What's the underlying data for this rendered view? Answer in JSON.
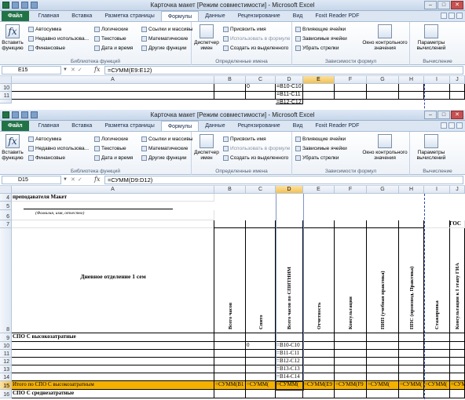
{
  "window1": {
    "title": "Карточка макет  [Режим совместимости] - Microsoft Excel",
    "name_box": "E15",
    "formula": "=СУММ(E9:E12)",
    "rows": [
      "10",
      "11"
    ],
    "cells": {
      "C10": "0",
      "D10": "=B10-C10",
      "D11": "=B11-C11",
      "D12": "=B12-C12"
    }
  },
  "window2": {
    "title": "Карточка макет  [Режим совместимости] - Microsoft Excel",
    "name_box": "D15",
    "formula": "=СУММ(D9:D12)",
    "rows": [
      "4",
      "5",
      "6",
      "7",
      "8",
      "9",
      "10",
      "11",
      "12",
      "13",
      "14",
      "15",
      "16"
    ],
    "cells": {
      "A4": "преподавателя Макет",
      "A6": "(Фамилия, имя, отчество)",
      "I7": "ГОС",
      "A8": "Дневное отделение 1 сем",
      "A9": "СПО С высокозатратные",
      "C10": "0",
      "D10": "=B10-C10",
      "D11": "=B11-C11",
      "D12": "=B12-C12",
      "D13": "=B13-C13",
      "D14": "=B14-C14",
      "A15": "Итого по СПО С высокозатратным",
      "B15": "=СУММ(B1",
      "C15": "=СУММ(",
      "D15": "=СУММ(",
      "E15": "=СУММ(E9",
      "F15": "=СУММ(F9",
      "G15": "=СУММ(",
      "H15": "=СУММ(",
      "I15": "=СУММ(",
      "J15": "=СУММ(",
      "A16": "СПО С среднезатратные"
    },
    "vertical_headers": {
      "B8": "Всего часов",
      "C8": "Спито",
      "D8": "Всего часов по СПИТНИМ",
      "E8": "Отчетность",
      "F8": "Консультации",
      "G8": "ПИП (учебная практика)",
      "H8": "ППС (производ. Практика)",
      "I8": "Стажировка",
      "J8": "Консультации к I этапу ГИА"
    }
  },
  "columns": [
    "A",
    "B",
    "C",
    "D",
    "E",
    "F",
    "G",
    "H",
    "I",
    "J"
  ],
  "tabs": [
    "Файл",
    "Главная",
    "Вставка",
    "Разметка страницы",
    "Формулы",
    "Данные",
    "Рецензирование",
    "Вид",
    "Foxit Reader PDF"
  ],
  "ribbon": {
    "insert_function": "Вставить функцию",
    "autosum": "Автосумма",
    "recent": "Недавно использова...",
    "financial": "Финансовые",
    "logical": "Логические",
    "text": "Текстовые",
    "datetime": "Дата и время",
    "lookup": "Ссылки и массивы",
    "math": "Математические",
    "other": "Другие функции",
    "group_library": "Библиотека функций",
    "name_manager": "Диспетчер имен",
    "define_name": "Присвоить имя",
    "use_in_formula": "Использовать в формуле",
    "create_from_selection": "Создать из выделенного",
    "group_names": "Определенные имена",
    "trace_precedents": "Влияющие ячейки",
    "trace_dependents": "Зависимые ячейки",
    "remove_arrows": "Убрать стрелки",
    "watch_window": "Окно контрольного значения",
    "group_audit": "Зависимости формул",
    "calc_options": "Параметры вычислений",
    "group_calc": "Вычисление"
  },
  "colors": {
    "excel_green": "#217346",
    "highlight_orange": "#f5b100",
    "selected_header": "#f3c153"
  }
}
